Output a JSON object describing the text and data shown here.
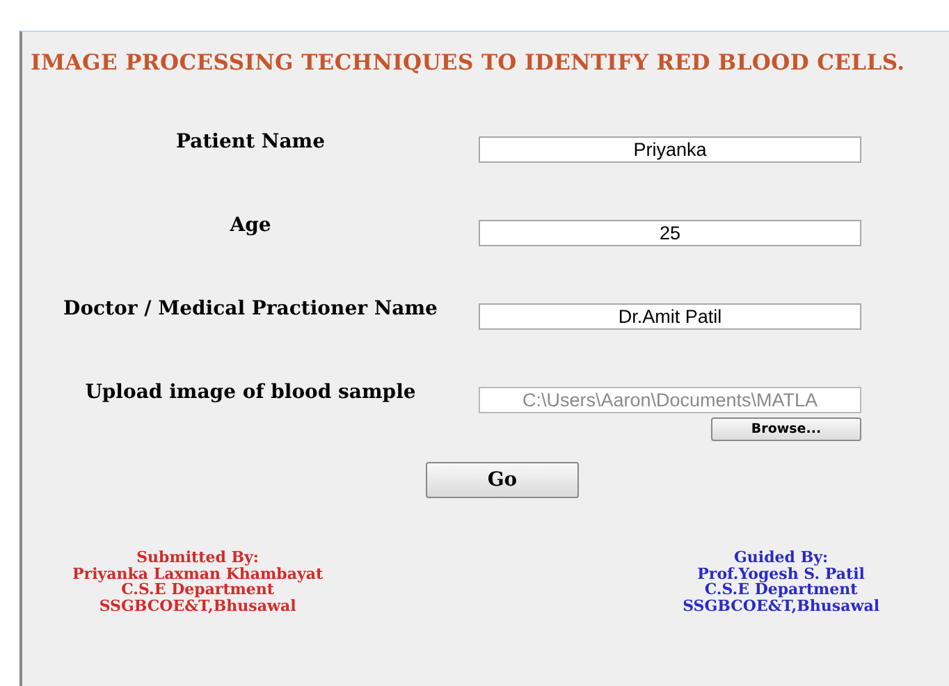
{
  "title": "IMAGE PROCESSING TECHNIQUES TO IDENTIFY RED BLOOD CELLS.",
  "fields": [
    {
      "label": "Patient Name",
      "value": "Priyanka",
      "disabled": false
    },
    {
      "label": "Age",
      "value": "25",
      "disabled": false
    },
    {
      "label": "Doctor / Medical Practioner Name",
      "value": "Dr.Amit Patil",
      "disabled": false
    },
    {
      "label": "Upload image of blood sample",
      "value": "C:\\Users\\Aaron\\Documents\\MATLA",
      "disabled": true
    }
  ],
  "browse_button": "Browse...",
  "go_button": "Go",
  "credits": [
    {
      "lines": [
        "Submitted By:",
        "Priyanka Laxman Khambayat",
        "C.S.E Department",
        "SSGBCOE&T,Bhusawal"
      ],
      "color": "#d42a2a"
    },
    {
      "lines": [
        "Guided By:",
        "Prof.Yogesh S. Patil",
        "C.S.E Department",
        "SSGBCOE&T,Bhusawal"
      ],
      "color": "#2a2ac8"
    }
  ]
}
